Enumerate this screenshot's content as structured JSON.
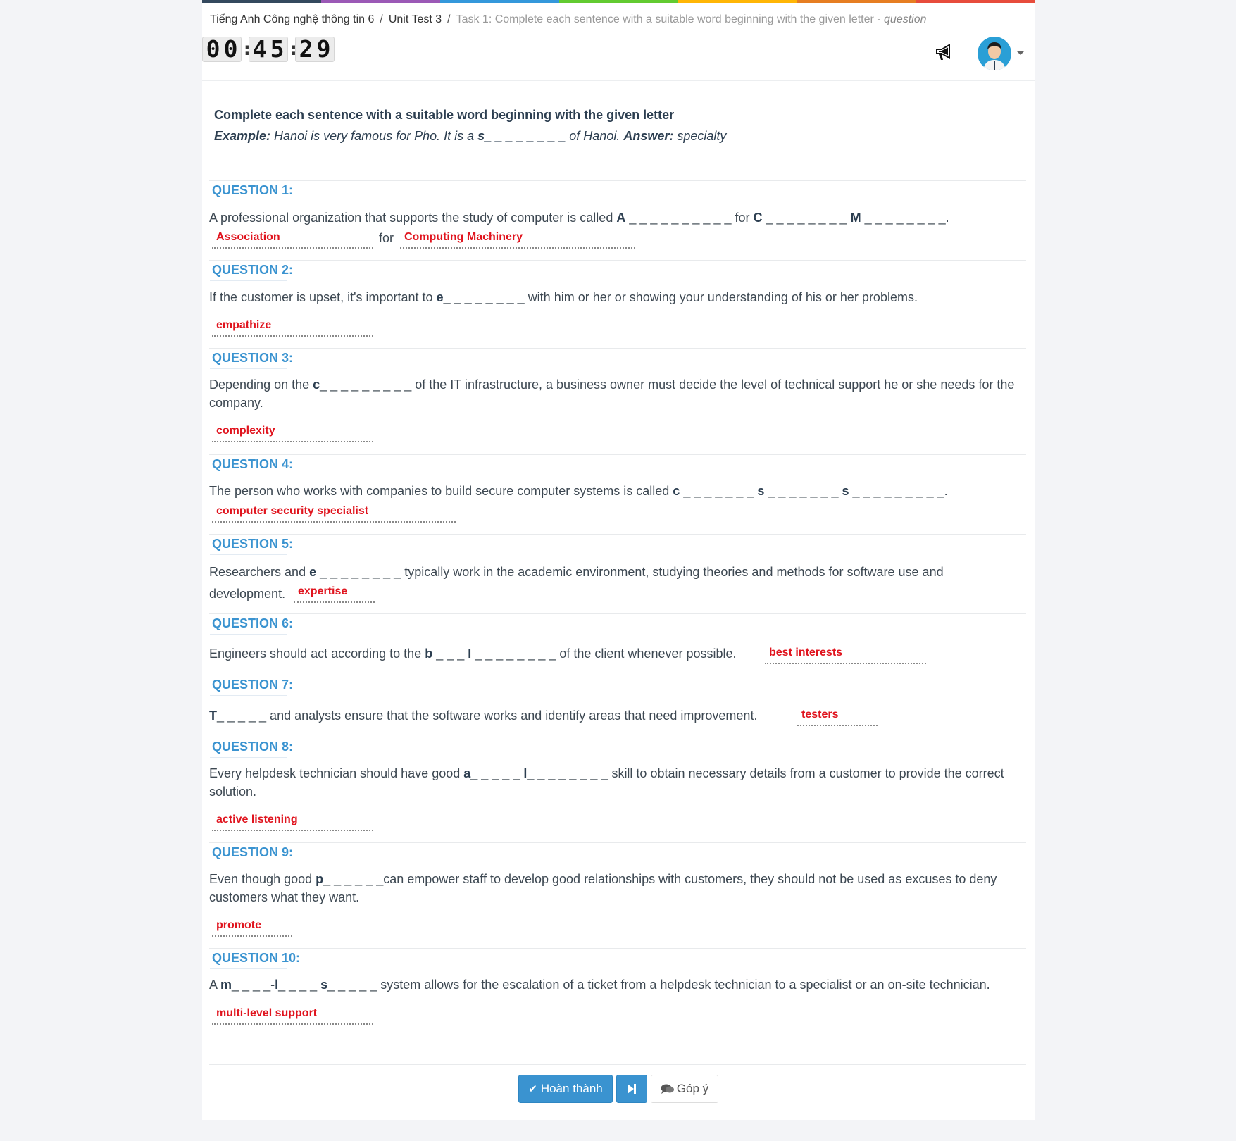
{
  "rainbow_colors": [
    "#34495e",
    "#9b59b6",
    "#3498db",
    "#62cb31",
    "#ffb606",
    "#e67e22",
    "#e74c3c"
  ],
  "breadcrumb": {
    "item1": "Tiếng Anh Công nghệ thông tin 6",
    "sep": "/",
    "item2": "Unit Test 3",
    "current": "Task 1: Complete each sentence with a suitable word beginning with the given letter",
    "current_suffix_sep": " - ",
    "current_suffix": "question"
  },
  "timer": {
    "h1": "0",
    "h2": "0",
    "m1": "4",
    "m2": "5",
    "s1": "2",
    "s2": "9",
    "colon": ":"
  },
  "header": {
    "announce_icon": "megaphone-icon",
    "avatar_icon": "user-avatar"
  },
  "instruction": {
    "title": "Complete each sentence with a suitable word beginning with the given letter",
    "example_label": "Example:",
    "example_text_1": " Hanoi is very famous for Pho. It is a ",
    "example_letter": "s_ _ _ _ _ _ _ _",
    "example_text_2": " of Hanoi. ",
    "answer_label": "Answer:",
    "answer_value": " specialty"
  },
  "questions": [
    {
      "label": "QUESTION 1:",
      "t1": "A professional organization that supports the study of computer is called ",
      "b1": "A",
      "t2": " _ _ _ _ _ _ _ _ _ _ for ",
      "b2": "C",
      "t3": " _ _ _ _ _ _ _ _ ",
      "b3": "M",
      "t4": " _ _ _ _ _ _ _ _.",
      "answers": [
        "Association",
        "Computing Machinery"
      ],
      "for_word": "for"
    },
    {
      "label": "QUESTION 2:",
      "t1": "If the customer is upset, it's important to ",
      "b1": "e",
      "t2": "_ _ _ _ _ _ _ _ with him or her or showing your understanding of his or her problems.",
      "answer": "empathize"
    },
    {
      "label": "QUESTION 3:",
      "t1": "Depending on the ",
      "b1": "c",
      "t2": "_ _ _ _ _ _ _ _ _ of the IT infrastructure, a business owner must decide the level of technical support he or she needs for the company.",
      "answer": "complexity"
    },
    {
      "label": "QUESTION 4:",
      "t1": "The person who works with companies to build secure computer systems is called ",
      "b1": "c",
      "t2": " _ _ _ _ _ _ _ ",
      "b2": "s",
      "t3": " _ _ _ _ _ _ _ ",
      "b3": "s",
      "t4": " _ _ _ _ _ _ _ _ _.",
      "answer": "computer security specialist"
    },
    {
      "label": "QUESTION 5:",
      "t1": "Researchers and ",
      "b1": "e",
      "t2": " _ _ _ _ _ _ _ _ typically work in the academic environment, studying theories and methods for software use and development.",
      "answer": "expertise"
    },
    {
      "label": "QUESTION 6:",
      "t1": "Engineers should act according to the ",
      "b1": "b",
      "t2": " _ _ _ ",
      "b2": "I",
      "t3": " _ _ _ _ _ _ _ _ of the client whenever possible.",
      "answer": "best interests"
    },
    {
      "label": "QUESTION 7:",
      "b1": "T",
      "t1": "_ _ _ _ _ and analysts ensure that the software works and identify areas that need improvement.",
      "answer": "testers"
    },
    {
      "label": "QUESTION 8:",
      "t1": "Every helpdesk technician should have good ",
      "b1": "a",
      "t2": "_ _ _ _ _ ",
      "b2": "l",
      "t3": "_ _ _ _ _ _ _ _ skill to obtain necessary details from a customer to provide the correct solution.",
      "answer": "active listening"
    },
    {
      "label": "QUESTION 9:",
      "t1": "Even though good ",
      "b1": "p",
      "t2": "_ _ _ _ _ _can empower staff to develop good relationships with customers, they should not be used as excuses to deny customers what they want.",
      "answer": "promote"
    },
    {
      "label": "QUESTION 10:",
      "t1": "A ",
      "b1": "m",
      "t2": "_ _ _ _-",
      "b2": "l",
      "t3": "_ _ _ _ ",
      "b3": "s",
      "t4": "_ _ _ _ _ system allows for the escalation of a ticket from a helpdesk technician to a specialist or an on-site technician.",
      "answer": "multi-level support"
    }
  ],
  "footer": {
    "finish_label": "Hoàn thành",
    "finish_icon": "check-icon",
    "next_icon": "skip-next-icon",
    "feedback_label": "Góp ý",
    "feedback_icon": "comment-icon"
  }
}
